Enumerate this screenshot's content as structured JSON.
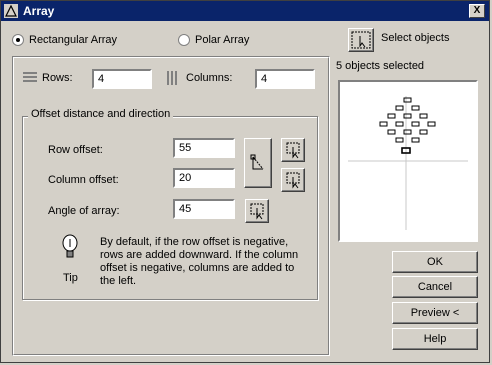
{
  "window": {
    "title": "Array",
    "close_label": "X"
  },
  "array_type": {
    "rectangular_label": "Rectangular Array",
    "polar_label": "Polar Array",
    "selected": "rectangular"
  },
  "grid": {
    "rows_label": "Rows:",
    "rows_value": "4",
    "columns_label": "Columns:",
    "columns_value": "4"
  },
  "offset": {
    "group_title": "Offset distance and direction",
    "row_offset_label": "Row offset:",
    "row_offset_value": "55",
    "column_offset_label": "Column offset:",
    "column_offset_value": "20",
    "angle_label": "Angle of array:",
    "angle_value": "45"
  },
  "tip": {
    "label": "Tip",
    "text": "By default, if the row offset is negative, rows are added downward.  If the column offset is negative, columns are added to the left."
  },
  "selection": {
    "select_objects_label": "Select objects",
    "status": "5 objects selected"
  },
  "buttons": {
    "ok": "OK",
    "cancel": "Cancel",
    "preview": "Preview <",
    "help": "Help"
  },
  "colors": {
    "titlebar": "#0a246a",
    "face": "#d4d0c8",
    "preview_highlight": "#000000"
  }
}
